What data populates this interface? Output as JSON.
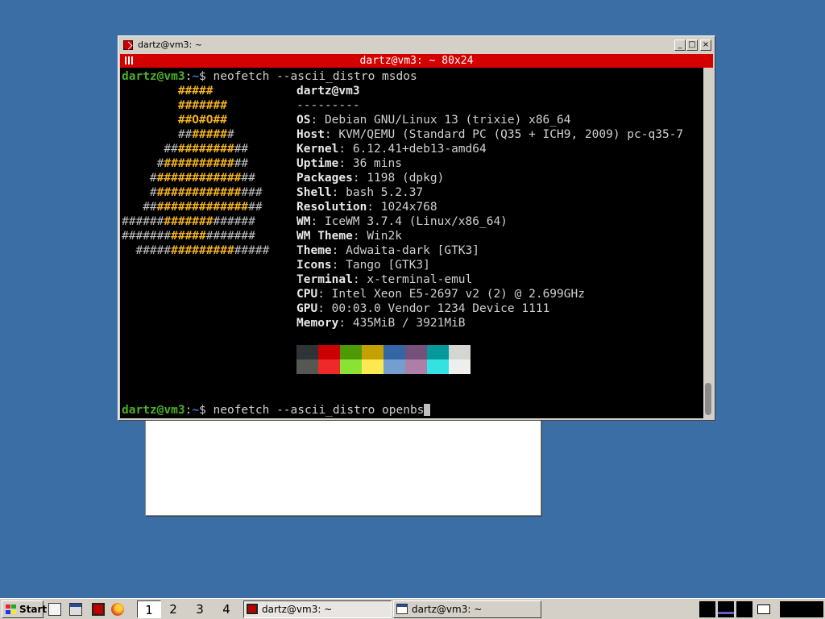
{
  "terminal_window": {
    "title": "dartz@vm3: ~",
    "xterm_title": "dartz@vm3: ~ 80x24",
    "buttons": {
      "minimize": "_",
      "maximize": "□",
      "close": "×"
    }
  },
  "terminal": {
    "prompt_user": "dartz@vm3",
    "prompt_sep": ":",
    "prompt_path": "~",
    "prompt_symbol": "$",
    "command1": " neofetch --ascii_distro msdos",
    "command2": " neofetch --ascii_distro openbs",
    "logo_lines": [
      [
        "        ",
        "",
        "#####",
        ""
      ],
      [
        "        ",
        "",
        "#######",
        ""
      ],
      [
        "        ",
        "",
        "##O#O##",
        ""
      ],
      [
        "        ",
        "##",
        "#####",
        "#"
      ],
      [
        "      ",
        "##",
        "########",
        "##"
      ],
      [
        "     ",
        "#",
        "##########",
        "##"
      ],
      [
        "    ",
        "#",
        "############",
        "##"
      ],
      [
        "    ",
        "#",
        "############",
        "###"
      ],
      [
        "   ",
        "##",
        "#############",
        "##"
      ],
      [
        "",
        "######",
        "#######",
        "######"
      ],
      [
        "",
        "#######",
        "#####",
        "#######"
      ],
      [
        "  ",
        "#####",
        "#########",
        "#####"
      ]
    ],
    "user_host": "dartz@vm3",
    "separator": "---------",
    "info": [
      {
        "label": "OS",
        "value": "Debian GNU/Linux 13 (trixie) x86_64"
      },
      {
        "label": "Host",
        "value": "KVM/QEMU (Standard PC (Q35 + ICH9, 2009) pc-q35-7"
      },
      {
        "label": "Kernel",
        "value": "6.12.41+deb13-amd64"
      },
      {
        "label": "Uptime",
        "value": "36 mins"
      },
      {
        "label": "Packages",
        "value": "1198 (dpkg)"
      },
      {
        "label": "Shell",
        "value": "bash 5.2.37"
      },
      {
        "label": "Resolution",
        "value": "1024x768"
      },
      {
        "label": "WM",
        "value": "IceWM 3.7.4 (Linux/x86_64)"
      },
      {
        "label": "WM Theme",
        "value": "Win2k"
      },
      {
        "label": "Theme",
        "value": "Adwaita-dark [GTK3]"
      },
      {
        "label": "Icons",
        "value": "Tango [GTK3]"
      },
      {
        "label": "Terminal",
        "value": "x-terminal-emul"
      },
      {
        "label": "CPU",
        "value": "Intel Xeon E5-2697 v2 (2) @ 2.699GHz"
      },
      {
        "label": "GPU",
        "value": "00:03.0 Vendor 1234 Device 1111"
      },
      {
        "label": "Memory",
        "value": "435MiB / 3921MiB"
      }
    ],
    "palette_dark": [
      "#2e3436",
      "#cc0000",
      "#4e9a06",
      "#c4a000",
      "#3465a4",
      "#75507b",
      "#06989a",
      "#d3d7cf"
    ],
    "palette_bright": [
      "#555753",
      "#ef2929",
      "#8ae234",
      "#fce94f",
      "#729fcf",
      "#ad7fa8",
      "#34e2e2",
      "#eeeeec"
    ]
  },
  "taskbar": {
    "start_label": "Start",
    "workspaces": [
      "1",
      "2",
      "3",
      "4"
    ],
    "active_workspace": "1",
    "tasks": [
      {
        "label": "dartz@vm3: ~",
        "icon": "terminal-icon",
        "active": true
      },
      {
        "label": "dartz@vm3: ~",
        "icon": "window-icon",
        "active": false
      }
    ]
  },
  "colors": {
    "desktop": "#3a6ea5",
    "xterm_title_bg": "#d40000",
    "prompt_user": "#4cae2b",
    "prompt_path": "#3f77d4",
    "logo_accent": "#f0b020"
  }
}
